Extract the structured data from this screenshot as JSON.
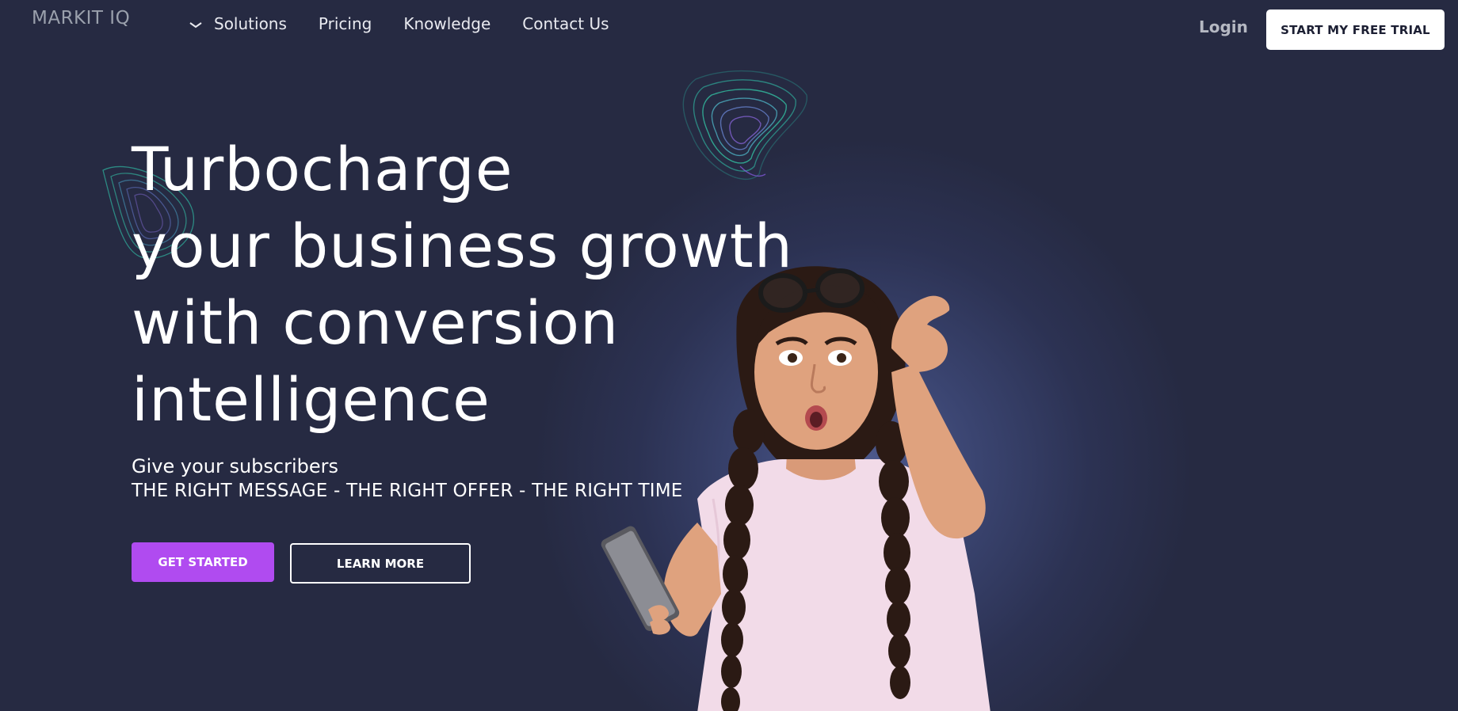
{
  "header": {
    "logo": "MARKIT IQ",
    "nav": [
      {
        "label": "Solutions",
        "icon": "chevron-down-icon"
      },
      {
        "label": "Pricing"
      },
      {
        "label": "Knowledge"
      },
      {
        "label": "Contact Us"
      }
    ],
    "login_label": "Login",
    "trial_label": "START MY FREE TRIAL"
  },
  "hero": {
    "headline_lines": [
      "Turbocharge",
      "your business growth",
      "with conversion",
      "intelligence"
    ],
    "subtitle": "Give your subscribers",
    "tagline": "THE RIGHT MESSAGE - THE RIGHT OFFER - THE RIGHT TIME",
    "primary_button": "GET STARTED",
    "secondary_button": "LEARN MORE"
  },
  "colors": {
    "background": "#262a42",
    "accent": "#b04bf0",
    "text": "#ffffff"
  }
}
